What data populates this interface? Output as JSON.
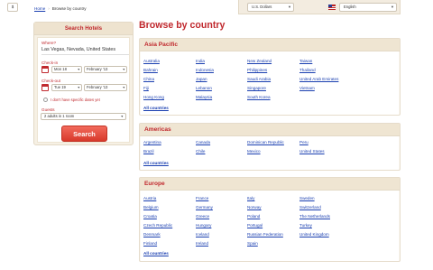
{
  "breadcrumb": {
    "home": "Home",
    "separator": "›",
    "current": "Browse by country"
  },
  "preferences": {
    "currency_symbol": "$",
    "currency": "U.S. Dollars",
    "language_flag": "us-flag-icon",
    "language": "English"
  },
  "search": {
    "title": "Search Hotels",
    "where_label": "Where?",
    "where_value": "Las Vegas, Nevada, United States",
    "checkin_label": "Check-in",
    "checkin_day": "Mon 18",
    "checkin_month": "February '13",
    "checkout_label": "Check-out",
    "checkout_day": "Tue 19",
    "checkout_month": "February '13",
    "no_dates_label": "I don't have specific dates yet",
    "guests_label": "Guests",
    "guests_value": "2 adults in 1 room",
    "button_label": "Search"
  },
  "page_title": "Browse by country",
  "regions": [
    {
      "name": "Asia Pacific",
      "columns": [
        [
          "Australia",
          "Bahrain",
          "China",
          "Fiji",
          "Hong Kong"
        ],
        [
          "India",
          "Indonesia",
          "Japan",
          "Lebanon",
          "Malaysia"
        ],
        [
          "New Zealand",
          "Philippines",
          "Saudi Arabia",
          "Singapore",
          "South Korea"
        ],
        [
          "Taiwan",
          "Thailand",
          "United Arab Emirates",
          "Vietnam"
        ]
      ],
      "all_label": "All countries"
    },
    {
      "name": "Americas",
      "columns": [
        [
          "Argentina",
          "Brazil"
        ],
        [
          "Canada",
          "Chile"
        ],
        [
          "Dominican Republic",
          "Mexico"
        ],
        [
          "Peru",
          "United States"
        ]
      ],
      "all_label": "All countries"
    },
    {
      "name": "Europe",
      "columns": [
        [
          "Austria",
          "Belgium",
          "Croatia",
          "Czech Republic",
          "Denmark",
          "Finland"
        ],
        [
          "France",
          "Germany",
          "Greece",
          "Hungary",
          "Iceland",
          "Ireland"
        ],
        [
          "Italy",
          "Norway",
          "Poland",
          "Portugal",
          "Russian Federation",
          "Spain"
        ],
        [
          "Sweden",
          "Switzerland",
          "The Netherlands",
          "Turkey",
          "United Kingdom"
        ]
      ],
      "all_label": "All countries"
    }
  ]
}
